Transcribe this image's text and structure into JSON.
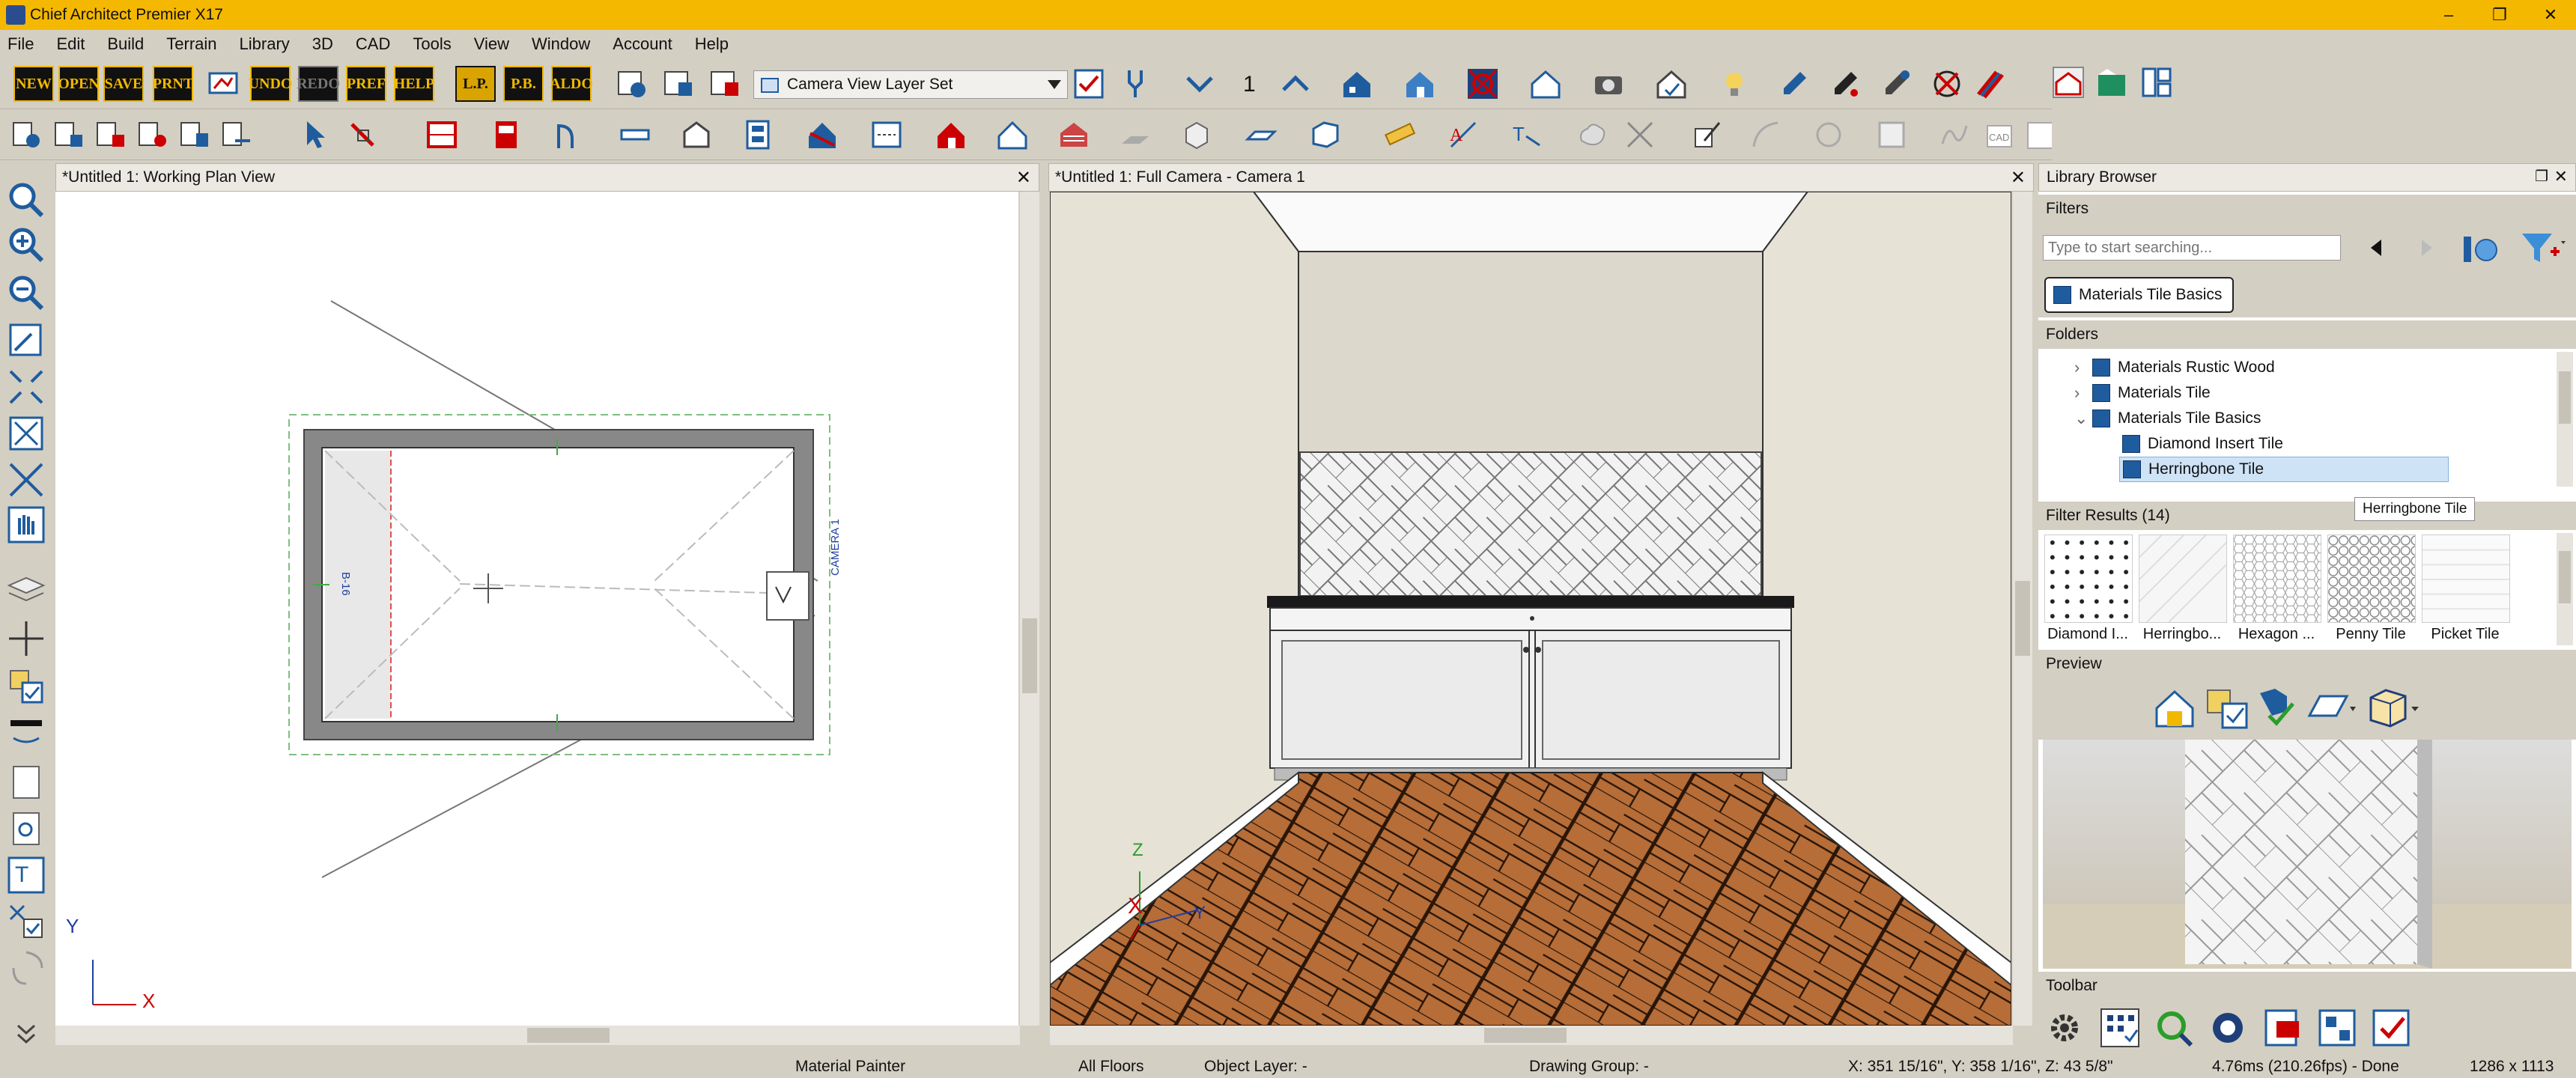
{
  "app_title": "Chief Architect Premier X17",
  "window_controls": {
    "minimize": "–",
    "restore": "❐",
    "close": "✕"
  },
  "menu": [
    "File",
    "Edit",
    "Build",
    "Terrain",
    "Library",
    "3D",
    "CAD",
    "Tools",
    "View",
    "Window",
    "Account",
    "Help"
  ],
  "toolbar1": {
    "word_buttons": [
      "NEW",
      "OPEN",
      "SAVE",
      "PRNT",
      "UNDO",
      "REDO",
      "PREF",
      "HELP",
      "L.P.",
      "P.B.",
      "ALDO"
    ],
    "layer_set": "Camera View Layer Set",
    "floor_number": "1"
  },
  "plan_view": {
    "title": "*Untitled 1:  Working Plan View",
    "room_label": "B-16",
    "camera_label": "CAMERA 1",
    "axis_y": "Y",
    "axis_x": "X"
  },
  "camera_view": {
    "title": "*Untitled 1: Full Camera - Camera 1",
    "axis_z": "Z",
    "axis_x": "X",
    "axis_y": "Y"
  },
  "library": {
    "title": "Library Browser",
    "filters_label": "Filters",
    "search_placeholder": "Type to start searching...",
    "filter_chip": "Materials Tile Basics",
    "folders_label": "Folders",
    "folders": [
      {
        "label": "Materials Rustic Wood",
        "expander": "›"
      },
      {
        "label": "Materials Tile",
        "expander": "›"
      },
      {
        "label": "Materials Tile Basics",
        "expander": "⌄"
      },
      {
        "label": "Diamond Insert Tile",
        "expander": ""
      },
      {
        "label": "Herringbone Tile",
        "expander": ""
      }
    ],
    "tooltip": "Herringbone Tile",
    "filter_results_label": "Filter Results (14)",
    "results": [
      "Diamond I...",
      "Herringbo...",
      "Hexagon ...",
      "Penny Tile",
      "Picket Tile"
    ],
    "preview_label": "Preview",
    "toolbar_label": "Toolbar"
  },
  "status": {
    "tool": "Material Painter",
    "floors": "All Floors",
    "object_layer": "Object Layer: -",
    "drawing_group": "Drawing Group: -",
    "coords": "X: 351 15/16\", Y: 358 1/16\", Z: 43 5/8\"",
    "timing": "4.76ms (210.26fps) - Done",
    "size": "1286 x 1113"
  }
}
